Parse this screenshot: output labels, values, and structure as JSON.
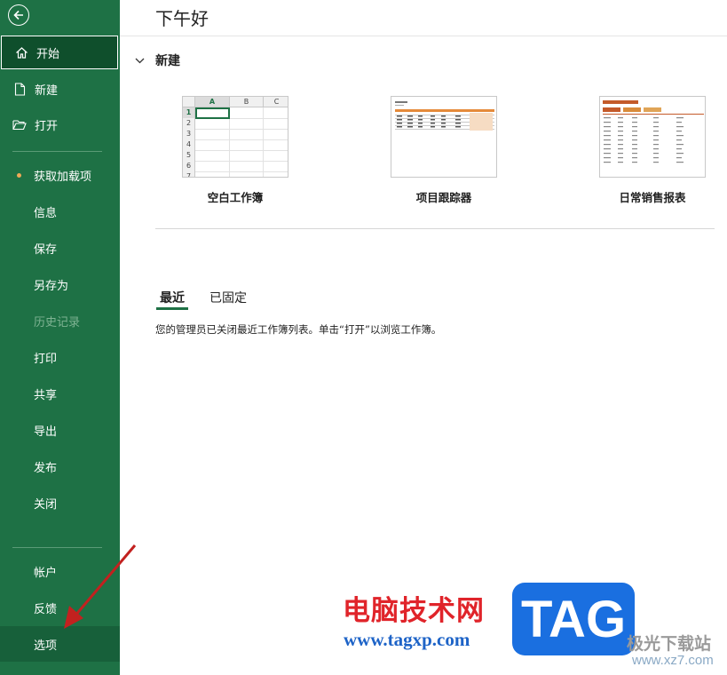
{
  "sidebar": {
    "items": [
      {
        "label": "开始",
        "icon": "home-icon"
      },
      {
        "label": "新建",
        "icon": "new-file-icon"
      },
      {
        "label": "打开",
        "icon": "open-folder-icon"
      },
      {
        "label": "获取加载项"
      },
      {
        "label": "信息"
      },
      {
        "label": "保存"
      },
      {
        "label": "另存为"
      },
      {
        "label": "历史记录"
      },
      {
        "label": "打印"
      },
      {
        "label": "共享"
      },
      {
        "label": "导出"
      },
      {
        "label": "发布"
      },
      {
        "label": "关闭"
      },
      {
        "label": "帐户"
      },
      {
        "label": "反馈"
      },
      {
        "label": "选项"
      }
    ],
    "accent": "#1e7145"
  },
  "main": {
    "greeting": "下午好",
    "new_section": "新建",
    "templates": [
      {
        "label": "空白工作簿"
      },
      {
        "label": "项目跟踪器"
      },
      {
        "label": "日常销售报表"
      }
    ],
    "blank_columns": [
      "A",
      "B",
      "C"
    ],
    "blank_rows": [
      "1",
      "2",
      "3",
      "4",
      "5",
      "6",
      "7"
    ],
    "tabs": [
      "最近",
      "已固定"
    ],
    "notice": "您的管理员已关闭最近工作簿列表。单击“打开”以浏览工作簿。"
  },
  "watermark": {
    "site_cn": "电脑技术网",
    "site_url": "www.tagxp.com",
    "tag": "TAG",
    "xz_cn": "极光下载站",
    "xz_url": "www.xz7.com"
  }
}
